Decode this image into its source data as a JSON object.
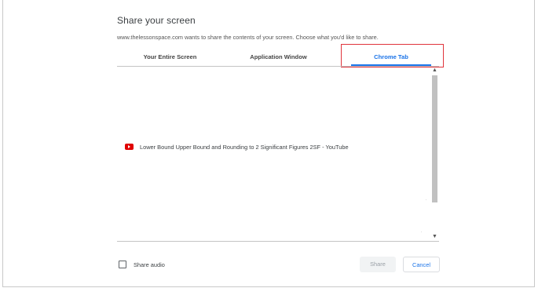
{
  "dialog": {
    "title": "Share your screen",
    "description": "www.thelessonspace.com wants to share the contents of your screen. Choose what you'd like to share."
  },
  "tabs": [
    {
      "label": "Your Entire Screen",
      "selected": false
    },
    {
      "label": "Application Window",
      "selected": false
    },
    {
      "label": "Chrome Tab",
      "selected": true
    }
  ],
  "tab_list": {
    "items": [
      {
        "icon": "youtube-icon",
        "label": "Lower Bound Upper Bound and Rounding to 2 Significant Figures 2SF - YouTube"
      }
    ],
    "scroll_up_glyph": "▲",
    "scroll_down_glyph": "▼"
  },
  "footer": {
    "audio_label": "Share audio",
    "audio_checked": false,
    "share_label": "Share",
    "cancel_label": "Cancel"
  },
  "colors": {
    "accent": "#1a73e8",
    "highlight": "#e0343b",
    "youtube": "#e00000"
  }
}
